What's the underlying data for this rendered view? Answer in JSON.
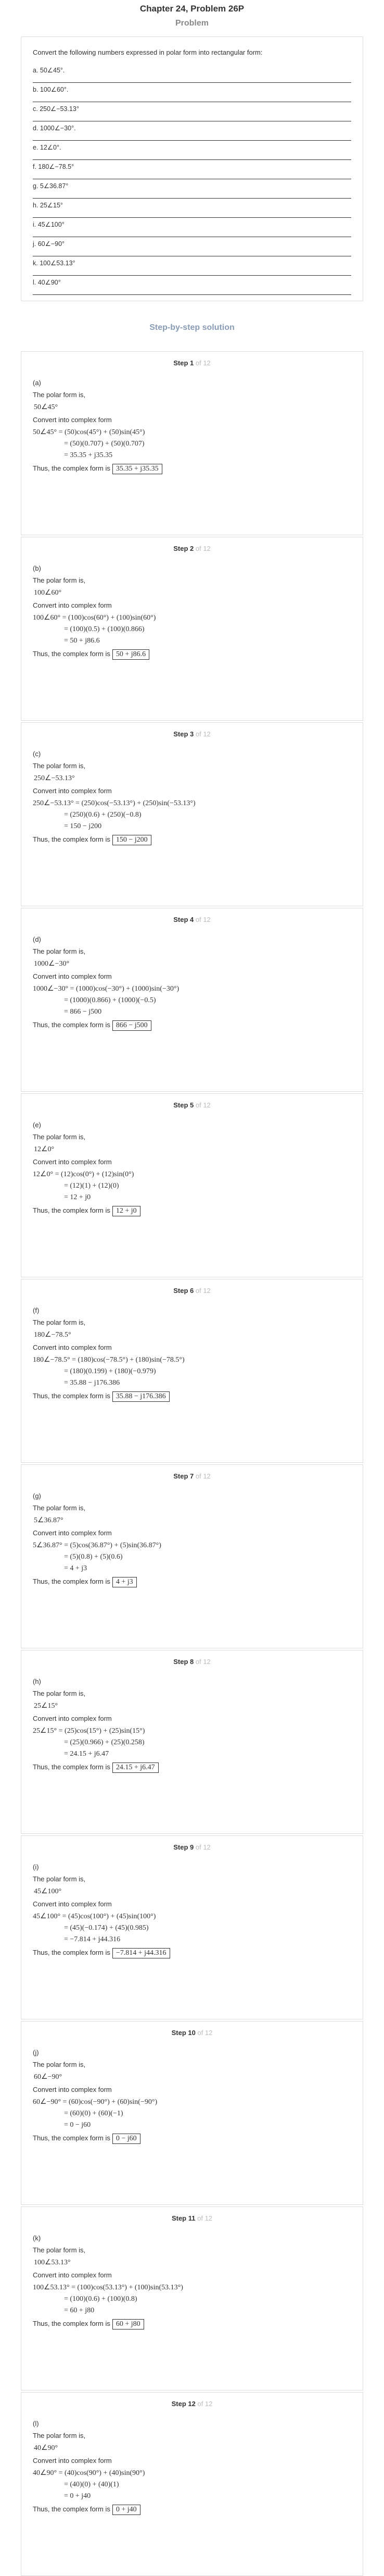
{
  "header": {
    "chapter_title": "Chapter 24, Problem 26P",
    "problem_label": "Problem"
  },
  "problem": {
    "intro": "Convert the following numbers expressed in polar form into rectangular form:",
    "items": [
      "a. 50∠45°.",
      "b. 100∠60°.",
      "c. 250∠−53.13°",
      "d. 1000∠−30°.",
      "e. 12∠0°.",
      "f. 180∠−78.5°",
      "g. 5∠36.87°",
      "h. 25∠15°",
      "i. 45∠100°",
      "j. 60∠−90°",
      "k. 100∠53.13°",
      "l. 40∠90°"
    ]
  },
  "solution": {
    "header": "Step-by-step solution",
    "steps": [
      {
        "step_label": "Step 1",
        "of_label": "of 12",
        "part": "(a)",
        "polar_intro": "The polar form is,",
        "polar": "50∠45°",
        "convert_label": "Convert into complex form",
        "eq1": "50∠45° = (50)cos(45°) + (50)sin(45°)",
        "eq2": "= (50)(0.707) + (50)(0.707)",
        "eq3": "= 35.35 + j35.35",
        "result_label": "Thus, the complex form is",
        "result": "35.35 + j35.35"
      },
      {
        "step_label": "Step 2",
        "of_label": "of 12",
        "part": "(b)",
        "polar_intro": "The polar form is,",
        "polar": "100∠60°",
        "convert_label": "Convert into complex form",
        "eq1": "100∠60° = (100)cos(60°) + (100)sin(60°)",
        "eq2": "= (100)(0.5) + (100)(0.866)",
        "eq3": "= 50 + j86.6",
        "result_label": "Thus, the complex form is",
        "result": "50 + j86.6"
      },
      {
        "step_label": "Step 3",
        "of_label": "of 12",
        "part": "(c)",
        "polar_intro": "The polar form is,",
        "polar": "250∠−53.13°",
        "convert_label": "Convert into complex form",
        "eq1": "250∠−53.13° = (250)cos(−53.13°) + (250)sin(−53.13°)",
        "eq2": "= (250)(0.6) + (250)(−0.8)",
        "eq3": "= 150 − j200",
        "result_label": "Thus, the complex form is",
        "result": "150 − j200"
      },
      {
        "step_label": "Step 4",
        "of_label": "of 12",
        "part": "(d)",
        "polar_intro": "The polar form is,",
        "polar": "1000∠−30°",
        "convert_label": "Convert into complex form",
        "eq1": "1000∠−30° = (1000)cos(−30°) + (1000)sin(−30°)",
        "eq2": "= (1000)(0.866) + (1000)(−0.5)",
        "eq3": "= 866 − j500",
        "result_label": "Thus, the complex form is",
        "result": "866 − j500"
      },
      {
        "step_label": "Step 5",
        "of_label": "of 12",
        "part": "(e)",
        "polar_intro": "The polar form is,",
        "polar": "12∠0°",
        "convert_label": "Convert into complex form",
        "eq1": "12∠0° = (12)cos(0°) + (12)sin(0°)",
        "eq2": "= (12)(1) + (12)(0)",
        "eq3": "= 12 + j0",
        "result_label": "Thus, the complex form is",
        "result": "12 + j0"
      },
      {
        "step_label": "Step 6",
        "of_label": "of 12",
        "part": "(f)",
        "polar_intro": "The polar form is,",
        "polar": "180∠−78.5°",
        "convert_label": "Convert into complex form",
        "eq1": "180∠−78.5° = (180)cos(−78.5°) + (180)sin(−78.5°)",
        "eq2": "= (180)(0.199) + (180)(−0.979)",
        "eq3": "= 35.88 − j176.386",
        "result_label": "Thus, the complex form is",
        "result": "35.88 − j176.386"
      },
      {
        "step_label": "Step 7",
        "of_label": "of 12",
        "part": "(g)",
        "polar_intro": "The polar form is,",
        "polar": "5∠36.87°",
        "convert_label": "Convert into complex form",
        "eq1": "5∠36.87° = (5)cos(36.87°) + (5)sin(36.87°)",
        "eq2": "= (5)(0.8) + (5)(0.6)",
        "eq3": "= 4 + j3",
        "result_label": "Thus, the complex form is",
        "result": "4 + j3"
      },
      {
        "step_label": "Step 8",
        "of_label": "of 12",
        "part": "(h)",
        "polar_intro": "The polar form is,",
        "polar": "25∠15°",
        "convert_label": "Convert into complex form",
        "eq1": "25∠15° = (25)cos(15°) + (25)sin(15°)",
        "eq2": "= (25)(0.966) + (25)(0.258)",
        "eq3": "= 24.15 + j6.47",
        "result_label": "Thus, the complex form is",
        "result": "24.15 + j6.47"
      },
      {
        "step_label": "Step 9",
        "of_label": "of 12",
        "part": "(i)",
        "polar_intro": "The polar form is,",
        "polar": "45∠100°",
        "convert_label": "Convert into complex form",
        "eq1": "45∠100° = (45)cos(100°) + (45)sin(100°)",
        "eq2": "= (45)(−0.174) + (45)(0.985)",
        "eq3": "= −7.814 + j44.316",
        "result_label": "Thus, the complex form is",
        "result": "−7.814 + j44.316"
      },
      {
        "step_label": "Step 10",
        "of_label": "of 12",
        "part": "(j)",
        "polar_intro": "The polar form is,",
        "polar": "60∠−90°",
        "convert_label": "Convert into complex form",
        "eq1": "60∠−90° = (60)cos(−90°) + (60)sin(−90°)",
        "eq2": "= (60)(0) + (60)(−1)",
        "eq3": "= 0 − j60",
        "result_label": "Thus, the complex form is",
        "result": "0 − j60"
      },
      {
        "step_label": "Step 11",
        "of_label": "of 12",
        "part": "(k)",
        "polar_intro": "The polar form is,",
        "polar": "100∠53.13°",
        "convert_label": "Convert into complex form",
        "eq1": "100∠53.13° = (100)cos(53.13°) + (100)sin(53.13°)",
        "eq2": "= (100)(0.6) + (100)(0.8)",
        "eq3": "= 60 + j80",
        "result_label": "Thus, the complex form is",
        "result": "60 + j80"
      },
      {
        "step_label": "Step 12",
        "of_label": "of 12",
        "part": "(l)",
        "polar_intro": "The polar form is,",
        "polar": "40∠90°",
        "convert_label": "Convert into complex form",
        "eq1": "40∠90° = (40)cos(90°) + (40)sin(90°)",
        "eq2": "= (40)(0) + (40)(1)",
        "eq3": "= 0 + j40",
        "result_label": "Thus, the complex form is",
        "result": "0 + j40"
      }
    ]
  }
}
